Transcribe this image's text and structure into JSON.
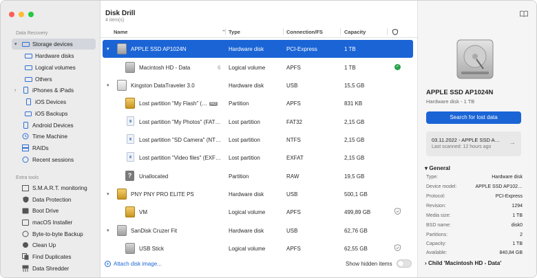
{
  "app": {
    "title": "Disk Drill",
    "subtitle": "4 item(s)"
  },
  "sidebar": {
    "data_recovery_label": "Data Recovery",
    "storage_devices": "Storage devices",
    "hardware_disks": "Hardware disks",
    "logical_volumes": "Logical volumes",
    "others": "Others",
    "iphones_ipads": "iPhones & iPads",
    "ios_devices": "iOS Devices",
    "ios_backups": "iOS Backups",
    "android_devices": "Android Devices",
    "time_machine": "Time Machine",
    "raids": "RAIDs",
    "recent_sessions": "Recent sessions",
    "extra_tools_label": "Extra tools",
    "smart_monitoring": "S.M.A.R.T. monitoring",
    "data_protection": "Data Protection",
    "boot_drive": "Boot Drive",
    "macos_installer": "macOS Installer",
    "byte_backup": "Byte-to-byte Backup",
    "clean_up": "Clean Up",
    "find_duplicates": "Find Duplicates",
    "data_shredder": "Data Shredder"
  },
  "columns": {
    "name": "Name",
    "type": "Type",
    "connection": "Connection/FS",
    "capacity": "Capacity"
  },
  "rows": [
    {
      "name": "APPLE SSD AP1024N",
      "type": "Hardware disk",
      "conn": "PCI-Express",
      "cap": "1 TB"
    },
    {
      "name": "Macintosh HD - Data",
      "badge": "6",
      "type": "Logical volume",
      "conn": "APFS",
      "cap": "1 TB"
    },
    {
      "name": "Kingston DataTraveler 3.0",
      "type": "Hardware disk",
      "conn": "USB",
      "cap": "15,5 GB"
    },
    {
      "name": "Lost partition \"My Flash\" (…",
      "ro": "RO",
      "type": "Partition",
      "conn": "APFS",
      "cap": "831 KB"
    },
    {
      "name": "Lost partition \"My Photos\" (FAT…",
      "type": "Lost partition",
      "conn": "FAT32",
      "cap": "2,15 GB"
    },
    {
      "name": "Lost partition \"SD Camera\" (NT…",
      "type": "Lost partition",
      "conn": "NTFS",
      "cap": "2,15 GB"
    },
    {
      "name": "Lost partition \"Video files\" (EXF…",
      "type": "Lost partition",
      "conn": "EXFAT",
      "cap": "2,15 GB"
    },
    {
      "name": "Unallocated",
      "type": "Partition",
      "conn": "RAW",
      "cap": "19,5 GB"
    },
    {
      "name": "PNY PNY PRO ELITE PS",
      "type": "Hardware disk",
      "conn": "USB",
      "cap": "500,1 GB"
    },
    {
      "name": "VM",
      "type": "Logical volume",
      "conn": "APFS",
      "cap": "499,89 GB"
    },
    {
      "name": "SanDisk Cruzer Fit",
      "type": "Hardware disk",
      "conn": "USB",
      "cap": "62,76 GB"
    },
    {
      "name": "USB Stick",
      "type": "Logical volume",
      "conn": "APFS",
      "cap": "62,55 GB"
    }
  ],
  "footer": {
    "attach": "Attach disk image...",
    "show_hidden": "Show hidden items"
  },
  "details": {
    "name": "APPLE SSD AP1024N",
    "sub": "Hardware disk - 1 TB",
    "search_button": "Search for lost data",
    "session_title": "03.11.2022 - APPLE SSD A…",
    "session_sub": "Last scanned: 12 hours ago",
    "general_label": "General",
    "child_label": "Child 'Macintosh HD - Data'",
    "props": [
      {
        "k": "Type:",
        "v": "Hardware disk"
      },
      {
        "k": "Device model:",
        "v": "APPLE SSD AP102…"
      },
      {
        "k": "Protocol:",
        "v": "PCI-Express"
      },
      {
        "k": "Revision:",
        "v": "1294"
      },
      {
        "k": "Media size:",
        "v": "1 TB"
      },
      {
        "k": "BSD name:",
        "v": "disk0"
      },
      {
        "k": "Partitions:",
        "v": "2"
      },
      {
        "k": "Capacity:",
        "v": "1 TB"
      },
      {
        "k": "Available:",
        "v": "840,84 GB"
      }
    ]
  },
  "colors": {
    "accent": "#1a64d6",
    "success": "#2aa14b"
  }
}
